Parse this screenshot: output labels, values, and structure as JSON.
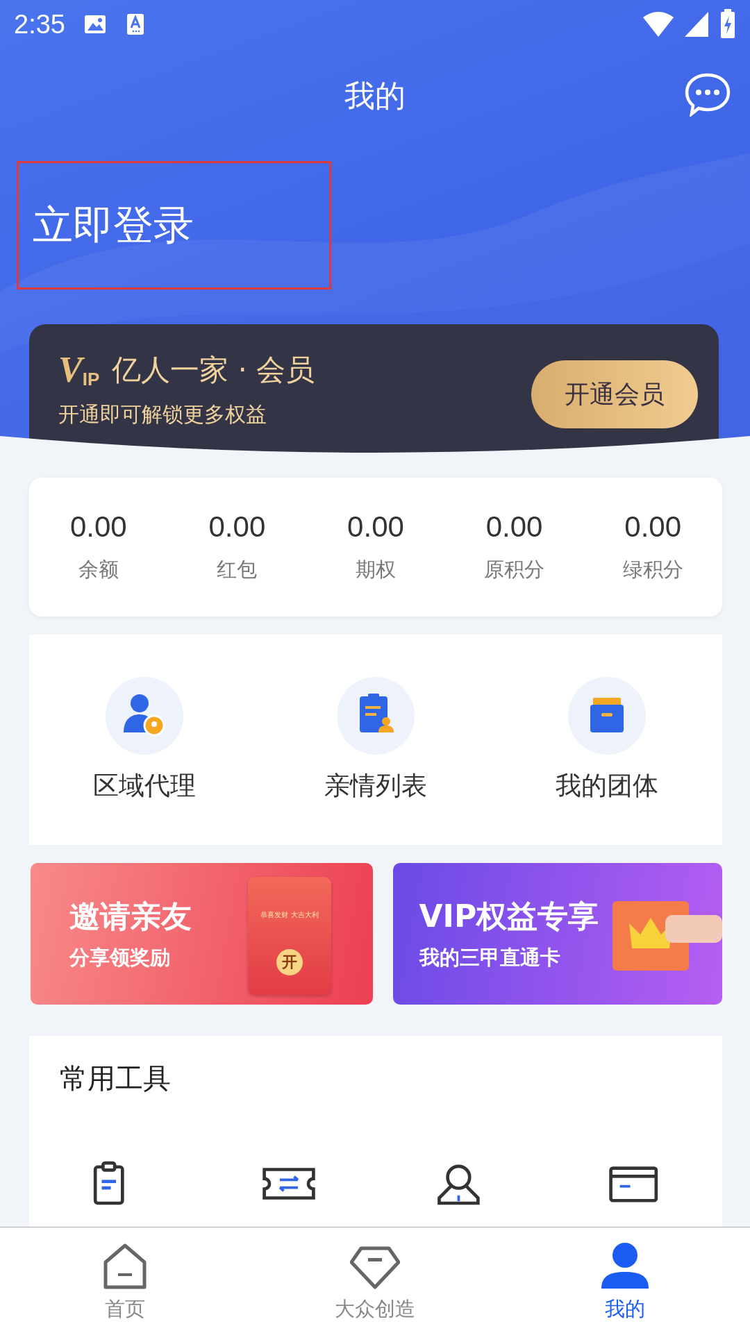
{
  "status_bar": {
    "time": "2:35"
  },
  "header": {
    "title": "我的"
  },
  "login": {
    "label": "立即登录"
  },
  "vip": {
    "logo": "VIP",
    "title": "亿人一家 · 会员",
    "subtitle": "开通即可解锁更多权益",
    "button": "开通会员"
  },
  "stats": [
    {
      "value": "0.00",
      "label": "余额"
    },
    {
      "value": "0.00",
      "label": "红包"
    },
    {
      "value": "0.00",
      "label": "期权"
    },
    {
      "value": "0.00",
      "label": "原积分"
    },
    {
      "value": "0.00",
      "label": "绿积分"
    }
  ],
  "features": [
    {
      "kind": "agent",
      "label": "区域代理"
    },
    {
      "kind": "family",
      "label": "亲情列表"
    },
    {
      "kind": "group",
      "label": "我的团体"
    }
  ],
  "banners": [
    {
      "kind": "invite",
      "title": "邀请亲友",
      "subtitle": "分享领奖励",
      "envelope_text": "恭喜发财 大吉大利",
      "envelope_seal": "开"
    },
    {
      "kind": "vip",
      "title": "VIP权益专享",
      "subtitle": "我的三甲直通卡"
    }
  ],
  "tools": {
    "title": "常用工具",
    "items": [
      {
        "kind": "clipboard"
      },
      {
        "kind": "ticket"
      },
      {
        "kind": "person"
      },
      {
        "kind": "card"
      }
    ]
  },
  "nav": [
    {
      "kind": "home",
      "label": "首页",
      "selected": false
    },
    {
      "kind": "diamond",
      "label": "大众创造",
      "selected": false
    },
    {
      "kind": "profile",
      "label": "我的",
      "selected": true
    }
  ]
}
